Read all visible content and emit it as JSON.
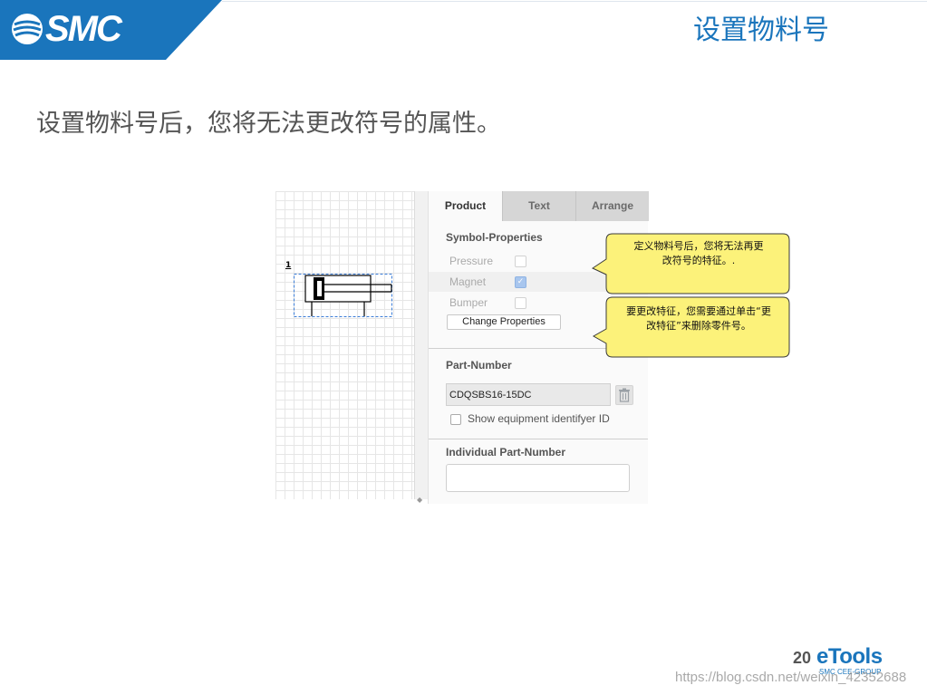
{
  "brand": {
    "logo_text": "SMC",
    "color": "#1a75bc"
  },
  "slide": {
    "title": "设置物料号",
    "subtitle": "设置物料号后，您将无法更改符号的属性。",
    "page_number": "20",
    "footer_brand": "eTools",
    "footer_brand_sub": "SMC CEE-GROUP"
  },
  "screenshot": {
    "symbol_number": "1",
    "tabs": [
      {
        "label": "Product",
        "active": true
      },
      {
        "label": "Text",
        "active": false
      },
      {
        "label": "Arrange",
        "active": false
      }
    ],
    "symbol_properties": {
      "title": "Symbol-Properties",
      "items": [
        {
          "label": "Pressure",
          "checked": false
        },
        {
          "label": "Magnet",
          "checked": true
        },
        {
          "label": "Bumper",
          "checked": false
        }
      ],
      "change_button": "Change Properties"
    },
    "part_number": {
      "title": "Part-Number",
      "value": "CDQSBS16-15DC",
      "show_id_label": "Show equipment identifyer ID",
      "show_id_checked": false
    },
    "individual_part_number": {
      "title": "Individual Part-Number",
      "value": ""
    }
  },
  "callouts": [
    {
      "text_line1": "定义物料号后，您将无法再更",
      "text_line2": "改符号的特征。."
    },
    {
      "text_line1": "要更改特征，您需要通过单击“更",
      "text_line2": "改特征”来删除零件号。"
    }
  ],
  "watermark": "https://blog.csdn.net/weixin_42352688"
}
